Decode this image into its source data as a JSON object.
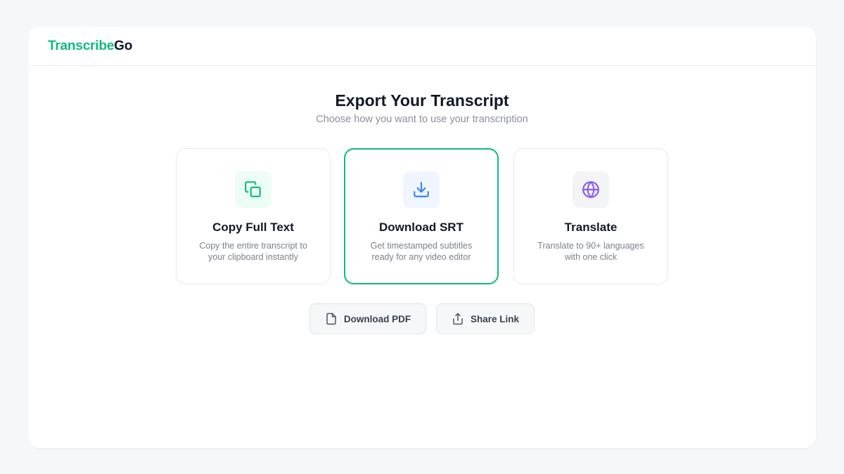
{
  "brand": {
    "part1": "Transcribe",
    "part2": "Go"
  },
  "header": {
    "title": "Export Your Transcript",
    "subtitle": "Choose how you want to use your transcription"
  },
  "options": [
    {
      "title": "Copy Full Text",
      "desc": "Copy the entire transcript to your clipboard instantly",
      "icon": "copy-icon",
      "color": "#10b981",
      "bg": "#ecfdf5",
      "selected": false
    },
    {
      "title": "Download SRT",
      "desc": "Get timestamped subtitles ready for any video editor",
      "icon": "download-icon",
      "color": "#3b82f6",
      "bg": "#eff6ff",
      "selected": true
    },
    {
      "title": "Translate",
      "desc": "Translate to 90+ languages with one click",
      "icon": "globe-icon",
      "color": "#8b5cf6",
      "bg": "#f3f4f6",
      "selected": false
    }
  ],
  "buttons": {
    "download_pdf": "Download PDF",
    "share_link": "Share Link"
  },
  "colors": {
    "accent": "#10b981",
    "background": "#f6f7f8"
  }
}
